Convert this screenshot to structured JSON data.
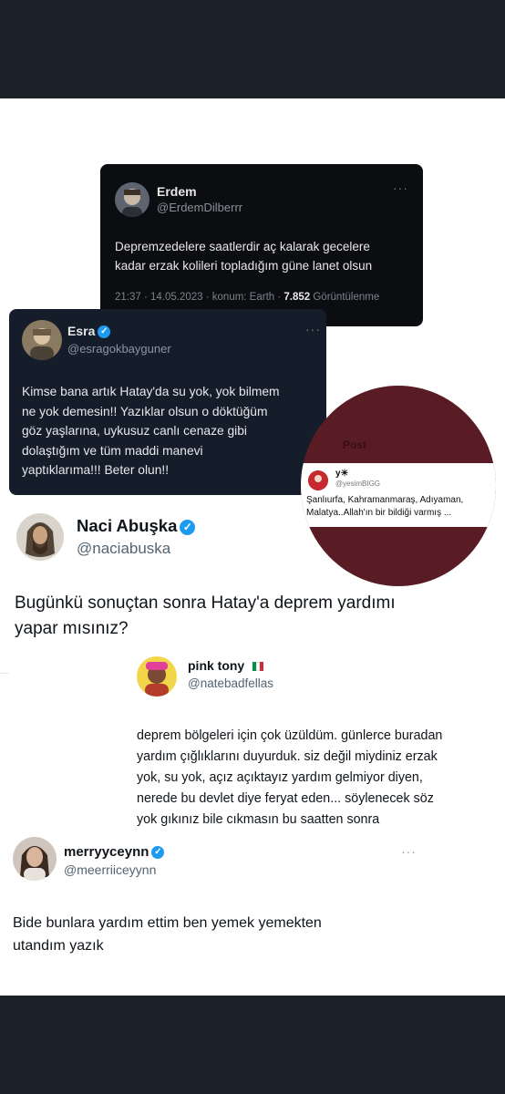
{
  "tweet_erdem": {
    "name": "Erdem",
    "handle": "@ErdemDilberrr",
    "text": "Depremzedelere saatlerdir aç kalarak gecelere\nkadar erzak kolileri topladığım güne lanet olsun",
    "meta_time": "21:37 · 14.05.2023 · konum: Earth · ",
    "meta_views": "7.852",
    "meta_views_label": " Görüntülenme",
    "menu": "···"
  },
  "tweet_esra": {
    "name": "Esra",
    "handle": "@esragokbayguner",
    "text": "Kimse bana artık Hatay'da su yok, yok bilmem\nne yok demesin!! Yazıklar olsun o döktüğüm\ngöz yaşlarına, uykusuz canlı cenaze gibi\ndolaştığım ve tüm maddi manevi\nyaptıklarıma!!! Beter olun!!",
    "menu": "···"
  },
  "tweet_yesim": {
    "name": "y☀",
    "handle": "@yesimBIGG",
    "text": "Şanlıurfa, Kahramanmaraş, Adıyaman,\nMalatya..Allah'ın bir bildiği varmış ...",
    "header_fragment": "Post"
  },
  "tweet_naci": {
    "name": "Naci Abuşka",
    "handle": "@naciabuska",
    "text": "Bugünkü sonuçtan sonra Hatay'a deprem yardımı\nyapar mısınız?"
  },
  "tweet_pinktony": {
    "name": "pink tony",
    "handle": "@natebadfellas",
    "text": "deprem bölgeleri için çok üzüldüm. günlerce buradan\nyardım çığlıklarını duyurduk. siz değil miydiniz erzak\nyok, su yok, açız açıktayız yardım gelmiyor diyen,\nnerede bu devlet diye feryat eden... söylenecek söz\nyok  gıkınız bile cıkmasın bu saatten sonra",
    "flag_colors": [
      "#009246",
      "#ffffff",
      "#ce2b37"
    ]
  },
  "tweet_merry": {
    "name": "merryyceynn",
    "handle": "@meerriiceyynn",
    "text": "Bide bunlara yardım ettim ben yemek yemekten\nutandım yazık",
    "menu": "···"
  },
  "colors": {
    "verified": "#1d9bf0",
    "circle": "#5a1c24",
    "frame": "#1c2029"
  }
}
